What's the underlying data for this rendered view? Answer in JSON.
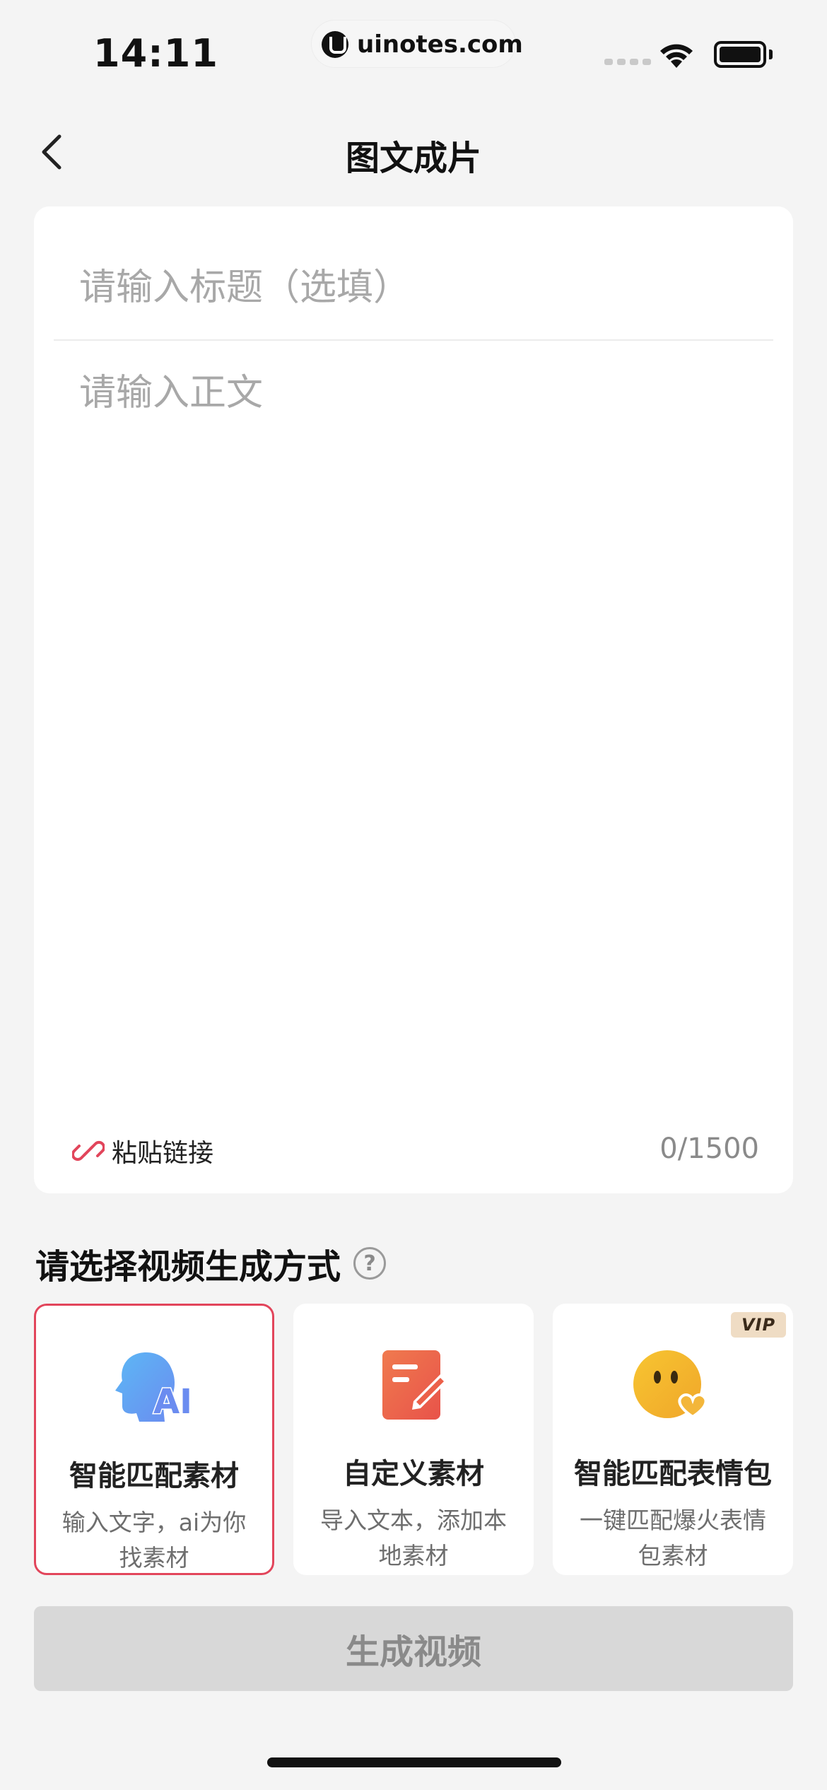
{
  "status_bar": {
    "time": "14:11",
    "url": "uinotes.com"
  },
  "nav": {
    "title": "图文成片"
  },
  "editor": {
    "title_placeholder": "请输入标题（选填）",
    "body_placeholder": "请输入正文",
    "paste_label": "粘贴链接",
    "char_count": "0/1500"
  },
  "section": {
    "title": "请选择视频生成方式",
    "help_symbol": "?"
  },
  "options": [
    {
      "title": "智能匹配素材",
      "desc": "输入文字，ai为你找素材",
      "icon": "ai-head-icon",
      "selected": true
    },
    {
      "title": "自定义素材",
      "desc": "导入文本，添加本地素材",
      "icon": "edit-doc-icon",
      "selected": false
    },
    {
      "title": "智能匹配表情包",
      "desc": "一键匹配爆火表情包素材",
      "icon": "emoji-face-icon",
      "selected": false,
      "badge": "VIP"
    }
  ],
  "generate_button": {
    "label": "生成视频"
  },
  "colors": {
    "accent": "#e2455b",
    "background": "#f4f4f4",
    "disabled_button": "#d8d8d8"
  }
}
